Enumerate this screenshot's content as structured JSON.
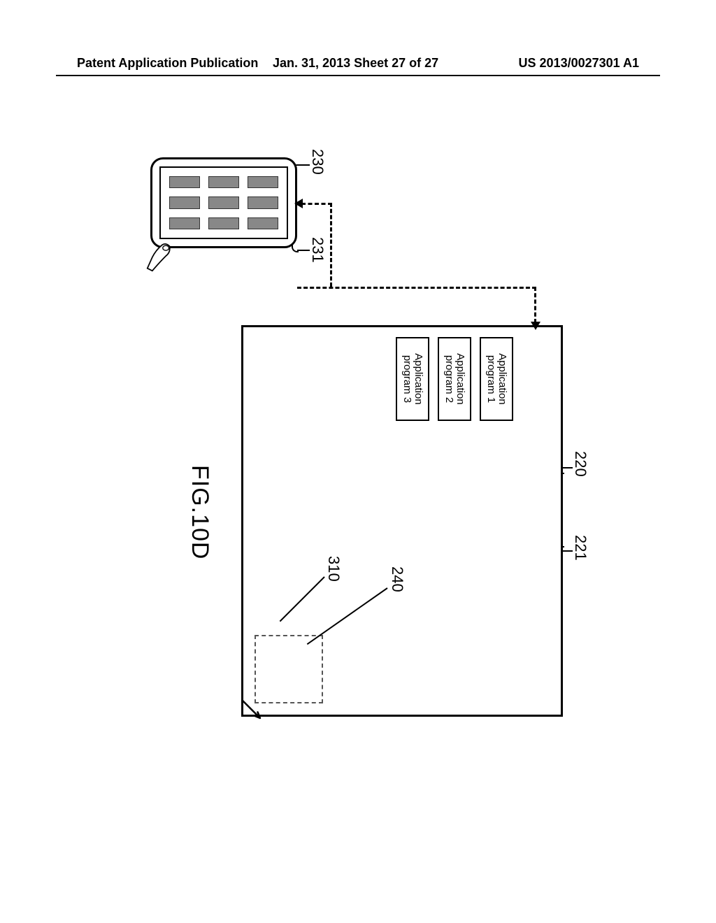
{
  "header": {
    "left": "Patent Application Publication",
    "center": "Jan. 31, 2013  Sheet 27 of 27",
    "right": "US 2013/0027301 A1"
  },
  "figure": {
    "caption": "FIG.10D",
    "labels": {
      "l220": "220",
      "l221": "221",
      "l230": "230",
      "l231": "231",
      "l240": "240",
      "l310": "310"
    },
    "apps": [
      {
        "line1": "Application",
        "line2": "program 1"
      },
      {
        "line1": "Application",
        "line2": "program 2"
      },
      {
        "line1": "Application",
        "line2": "program 3"
      }
    ]
  }
}
